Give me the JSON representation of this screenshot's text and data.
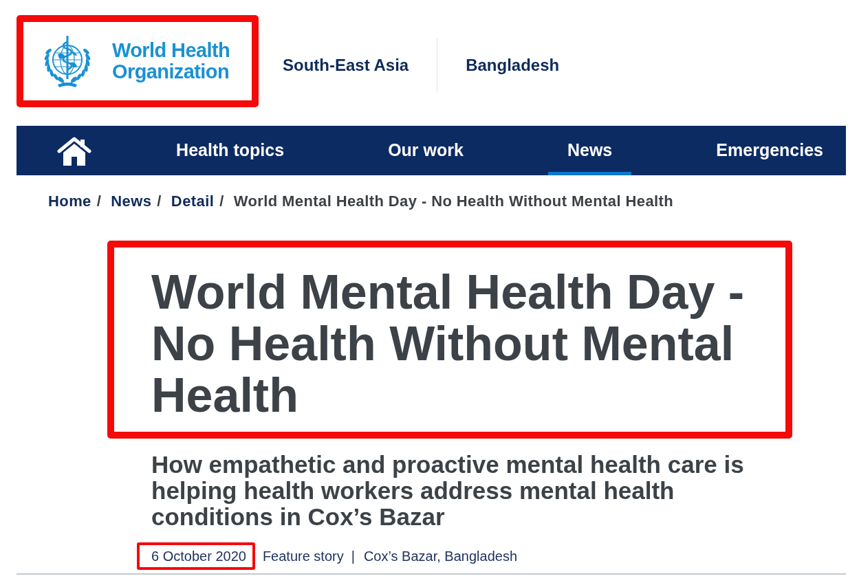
{
  "header": {
    "logo": {
      "lines": [
        "World Health",
        "Organization"
      ],
      "highlighted": true
    },
    "region_links": [
      {
        "label": "South-East Asia"
      },
      {
        "label": "Bangladesh"
      }
    ]
  },
  "nav": {
    "items": [
      {
        "kind": "home",
        "selected": false
      },
      {
        "kind": "text",
        "label": "Health topics",
        "selected": false
      },
      {
        "kind": "text",
        "label": "Our work",
        "selected": false
      },
      {
        "kind": "text",
        "label": "News",
        "selected": true
      },
      {
        "kind": "text",
        "label": "Emergencies",
        "selected": false
      }
    ]
  },
  "breadcrumb": [
    {
      "kind": "link",
      "label": "Home"
    },
    {
      "kind": "separator",
      "label": "/"
    },
    {
      "kind": "link",
      "label": "News"
    },
    {
      "kind": "separator",
      "label": "/"
    },
    {
      "kind": "link",
      "label": "Detail"
    },
    {
      "kind": "separator",
      "label": "/"
    },
    {
      "kind": "current",
      "label": "World Mental Health Day - No Health Without Mental Health"
    }
  ],
  "article": {
    "title": "World Mental Health Day - No Health Without Mental Health",
    "title_highlighted": true,
    "subtitle": "How empathetic and proactive mental health care is helping health workers address mental health conditions in Cox’s Bazar",
    "meta": [
      {
        "kind": "date",
        "text": "6 October 2020",
        "highlighted": true
      },
      {
        "kind": "type",
        "text": "Feature story",
        "highlighted": false
      },
      {
        "kind": "separator",
        "text": "|",
        "highlighted": false
      },
      {
        "kind": "location",
        "text": "Cox’s Bazar, Bangladesh",
        "highlighted": false
      }
    ]
  }
}
